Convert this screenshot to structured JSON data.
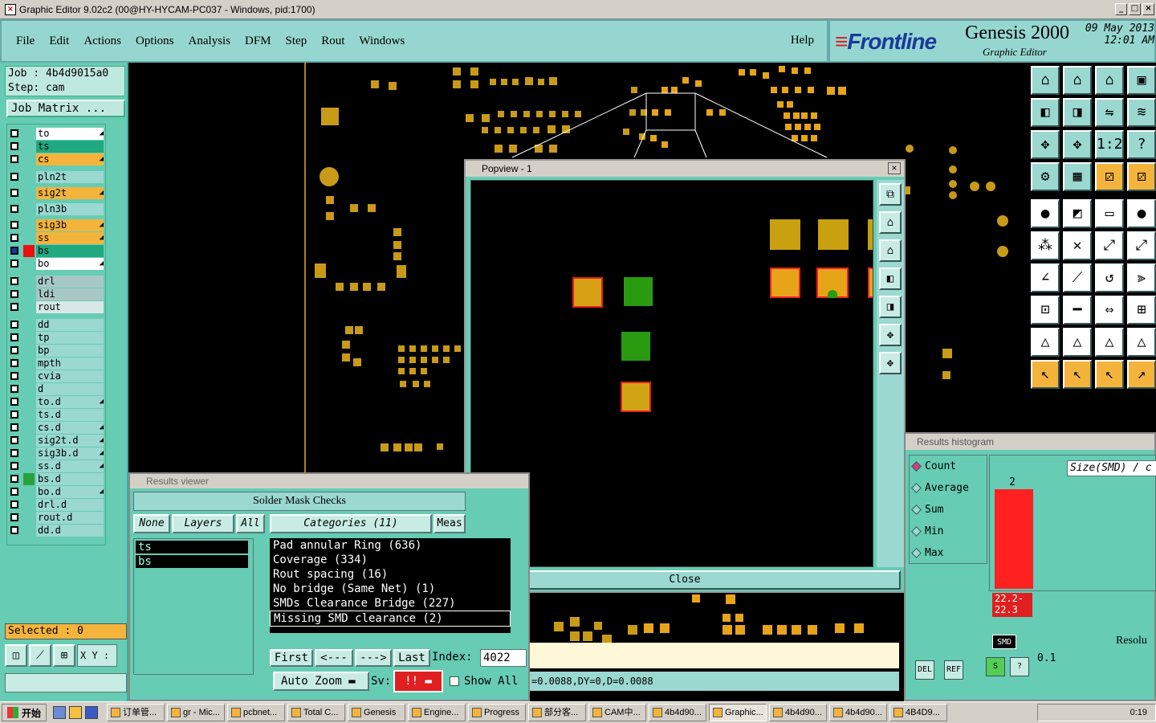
{
  "window": {
    "title": "Graphic Editor 9.02c2 (00@HY-HYCAM-PC037 - Windows, pid:1700)",
    "min": "_",
    "max": "□",
    "close": "×"
  },
  "menu": {
    "items": [
      "File",
      "Edit",
      "Actions",
      "Options",
      "Analysis",
      "DFM",
      "Step",
      "Rout",
      "Windows"
    ],
    "help": "Help"
  },
  "brand": {
    "logo": "Frontline",
    "product": "Genesis 2000",
    "subtitle": "Graphic Editor",
    "date_line1": "09 May 2013",
    "date_line2": "12:01 AM"
  },
  "job": {
    "job_label": "Job  : 4b4d9015a0",
    "step_label": "Step: cam",
    "matrix_button": "Job Matrix ..."
  },
  "layers": [
    {
      "name": "to",
      "color": "#ffffff",
      "arrow": true
    },
    {
      "name": "ts",
      "color": "#20a880",
      "arrow": false
    },
    {
      "name": "cs",
      "color": "#f4b43c",
      "arrow": true
    },
    {
      "name": "pln2t",
      "color": "#9ad8d0",
      "arrow": false
    },
    {
      "name": "sig2t",
      "color": "#f4b43c",
      "arrow": true
    },
    {
      "name": "pln3b",
      "color": "#9ad8d0",
      "arrow": false
    },
    {
      "name": "sig3b",
      "color": "#f4b43c",
      "arrow": true
    },
    {
      "name": "ss",
      "color": "#f4b43c",
      "arrow": true
    },
    {
      "name": "bs",
      "color": "#20a880",
      "arrow": false
    },
    {
      "name": "bo",
      "color": "#ffffff",
      "arrow": true
    },
    {
      "name": "drl",
      "color": "#a8c8c8",
      "arrow": false
    },
    {
      "name": "ldi",
      "color": "#a8c8c8",
      "arrow": false
    },
    {
      "name": "rout",
      "color": "#d8e8e8",
      "arrow": false
    },
    {
      "name": "dd",
      "color": "#9ad8d0",
      "arrow": false
    },
    {
      "name": "tp",
      "color": "#9ad8d0",
      "arrow": false
    },
    {
      "name": "bp",
      "color": "#9ad8d0",
      "arrow": false
    },
    {
      "name": "mpth",
      "color": "#9ad8d0",
      "arrow": false
    },
    {
      "name": "cvia",
      "color": "#9ad8d0",
      "arrow": false
    },
    {
      "name": "d",
      "color": "#9ad8d0",
      "arrow": false
    },
    {
      "name": "to.d",
      "color": "#9ad8d0",
      "arrow": true
    },
    {
      "name": "ts.d",
      "color": "#9ad8d0",
      "arrow": false
    },
    {
      "name": "cs.d",
      "color": "#9ad8d0",
      "arrow": true
    },
    {
      "name": "sig2t.d",
      "color": "#9ad8d0",
      "arrow": true
    },
    {
      "name": "sig3b.d",
      "color": "#9ad8d0",
      "arrow": true
    },
    {
      "name": "ss.d",
      "color": "#9ad8d0",
      "arrow": true
    },
    {
      "name": "bs.d",
      "color": "#9ad8d0",
      "arrow": false
    },
    {
      "name": "bo.d",
      "color": "#9ad8d0",
      "arrow": true
    },
    {
      "name": "drl.d",
      "color": "#9ad8d0",
      "arrow": false
    },
    {
      "name": "rout.d",
      "color": "#9ad8d0",
      "arrow": false
    },
    {
      "name": "dd.d",
      "color": "#9ad8d0",
      "arrow": false
    }
  ],
  "left": {
    "selected": "Selected : 0",
    "xy_label": "X Y :"
  },
  "popview": {
    "title": "Popview - 1",
    "close_label": "Close"
  },
  "results_viewer": {
    "title": "Results viewer",
    "heading": "Solder Mask Checks",
    "none_btn": "None",
    "layers_btn": "Layers",
    "all_btn": "All",
    "categories_btn": "Categories (11)",
    "meas_btn": "Meas",
    "layer_list": [
      "ts",
      "bs"
    ],
    "categories": [
      "Pad annular Ring (636)",
      "Coverage (334)",
      "Rout spacing (16)",
      "No bridge (Same Net) (1)",
      "SMDs Clearance Bridge (227)",
      "Missing SMD clearance (2)"
    ],
    "selected_category": "Missing SMD clearance (2)",
    "first": "First",
    "prev": "<---",
    "next": "--->",
    "last": "Last",
    "index_label": "Index:",
    "index_value": "4022",
    "auto_zoom": "Auto Zoom",
    "sv_label": "Sv:",
    "sv_value": "!!",
    "show_all": "Show All"
  },
  "status": {
    "measure": "=0.0088,DY=0,D=0.0088"
  },
  "histogram": {
    "title": "Results histogram",
    "options": [
      "Count",
      "Average",
      "Sum",
      "Min",
      "Max"
    ],
    "selected_option": "Count",
    "size_field": "Size(SMD) / c",
    "bar_count": "2",
    "bar_range_1": "22.2-",
    "bar_range_2": "22.3",
    "smd_badge": "SMD",
    "resolution": "Resolu",
    "resolution_value": "0.1",
    "del": "DEL",
    "ref": "REF"
  },
  "taskbar": {
    "start": "开始",
    "tasks": [
      "订单管...",
      "gr - Mic...",
      "pcbnet...",
      "Total C...",
      "Genesis",
      "Engine...",
      "Progress",
      "部分客...",
      "CAM中...",
      "4b4d90...",
      "Graphic...",
      "4b4d90...",
      "4b4d90...",
      "4B4D9..."
    ],
    "active_task": "Graphic...",
    "clock": "0:19"
  }
}
